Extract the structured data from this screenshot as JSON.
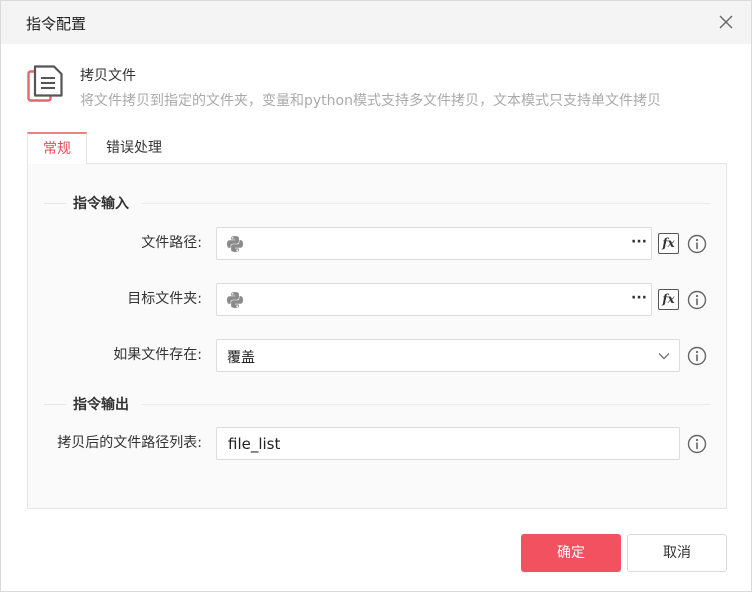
{
  "dialog": {
    "title": "指令配置"
  },
  "command": {
    "name": "拷贝文件",
    "description": "将文件拷贝到指定的文件夹，变量和python模式支持多文件拷贝，文本模式只支持单文件拷贝"
  },
  "tabs": [
    {
      "label": "常规",
      "active": true
    },
    {
      "label": "错误处理",
      "active": false
    }
  ],
  "sections": {
    "input": "指令输入",
    "output": "指令输出"
  },
  "fields": {
    "file_path": {
      "label": "文件路径:",
      "value": "",
      "more": "···"
    },
    "target_folder": {
      "label": "目标文件夹:",
      "value": "",
      "more": "···"
    },
    "if_exists": {
      "label": "如果文件存在:",
      "value": "覆盖"
    },
    "output_list": {
      "label": "拷贝后的文件路径列表:",
      "value": "file_list"
    }
  },
  "fx_label": "fx",
  "buttons": {
    "ok": "确定",
    "cancel": "取消"
  },
  "colors": {
    "accent": "#f25260",
    "tab_active": "#e84b55",
    "icon": "#e8656d"
  }
}
